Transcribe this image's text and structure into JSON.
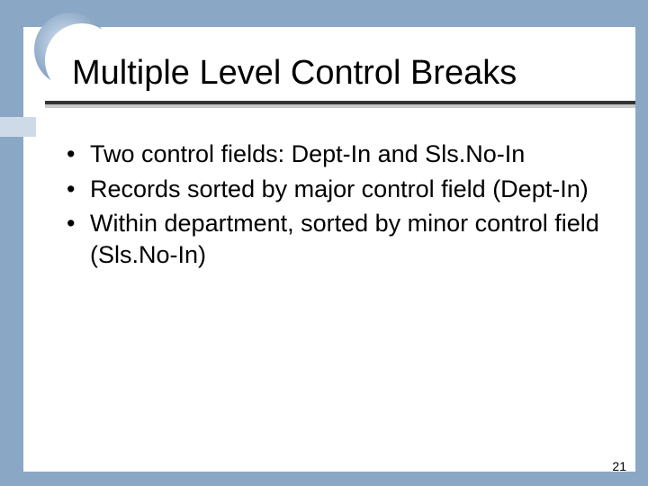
{
  "slide": {
    "title": "Multiple Level Control Breaks",
    "bullets": [
      "Two control fields: Dept-In and Sls.No-In",
      "Records sorted by major control field (Dept-In)",
      "Within department, sorted by minor control field (Sls.No-In)"
    ],
    "page_number": "21"
  }
}
